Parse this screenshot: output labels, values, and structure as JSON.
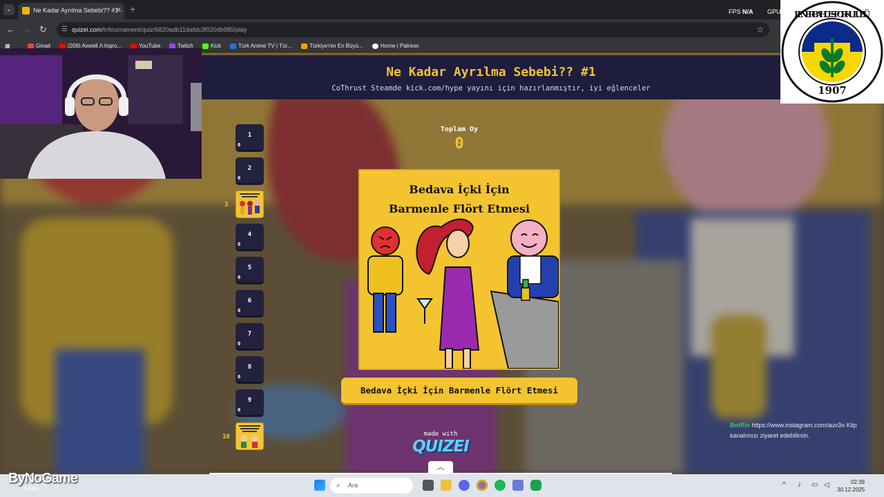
{
  "browser": {
    "tab_title": "Ne Kadar Ayrılma Sebebi?? #1 ·",
    "tab_close": "✕",
    "new_tab": "+",
    "fps_label": "FPS",
    "fps_value": "N/A",
    "gpu_label": "GPU",
    "url_domain": "quizei.com",
    "url_path": "/tr/tournament/quiz/6820adb11dafdc3f020db980/play",
    "bookmarks": [
      {
        "label": "Gmail",
        "color": "#ea4335"
      },
      {
        "label": "(206) Axwell Λ Ingro...",
        "color": "#ff0000"
      },
      {
        "label": "YouTube",
        "color": "#ff0000"
      },
      {
        "label": "Twitch",
        "color": "#9146ff"
      },
      {
        "label": "Kick",
        "color": "#53fc18"
      },
      {
        "label": "Türk Anime TV | Tür...",
        "color": "#2a6fdb"
      },
      {
        "label": "Türkiye'nin En Büyü...",
        "color": "#f4a300"
      },
      {
        "label": "Home | Patreon",
        "color": "#ffffff"
      }
    ]
  },
  "quiz": {
    "title": "Ne Kadar Ayrılma Sebebi?? #1",
    "subtitle": "CoThrust Steamde kick.com/hype yayını için hazırlanmıştır, iyi eğlenceler",
    "vote_label": "Toplam Oy",
    "vote_total": "0",
    "card_title_line1": "Bedava İçki İçin",
    "card_title_line2": "Barmenle Flört Etmesi",
    "answer_label": "Bedava İçki İçin Barmenle Flört Etmesi",
    "made_with": "made with",
    "brand": "QUIZEI",
    "slots": [
      {
        "number": "1",
        "votes": "0",
        "image": false
      },
      {
        "number": "2",
        "votes": "0",
        "image": false
      },
      {
        "number": "3",
        "votes": "",
        "image": true
      },
      {
        "number": "4",
        "votes": "0",
        "image": false
      },
      {
        "number": "5",
        "votes": "0",
        "image": false
      },
      {
        "number": "6",
        "votes": "0",
        "image": false
      },
      {
        "number": "7",
        "votes": "0",
        "image": false
      },
      {
        "number": "8",
        "votes": "0",
        "image": false
      },
      {
        "number": "9",
        "votes": "0",
        "image": false
      },
      {
        "number": "10",
        "votes": "",
        "image": true
      }
    ]
  },
  "overlay": {
    "logo_text": "FENERBAHÇE SPOR KULÜBÜ",
    "logo_year": "1907",
    "botrix_name": "BotRix",
    "botrix_message": "https://www.instagram.com/auv3n Klip kanalımızı ziyaret edebilirsin.",
    "bynogame": "ByNoGame",
    "weather": "Bulutlu"
  },
  "taskbar": {
    "search_placeholder": "Ara",
    "time": "02:39",
    "date": "30.12.2025"
  },
  "colors": {
    "accent_yellow": "#f4c430",
    "header_bg": "#1f1d3d",
    "slot_bg": "#23223e"
  }
}
